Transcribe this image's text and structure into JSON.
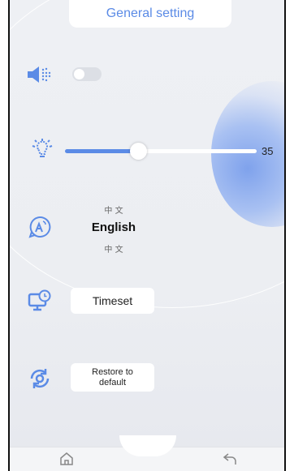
{
  "header": {
    "title": "General setting"
  },
  "sound": {
    "icon": "speaker-icon",
    "muted": true,
    "toggle_on": false
  },
  "brightness": {
    "icon": "lightbulb-icon",
    "value": "35",
    "level_fraction": 0.38
  },
  "language": {
    "icon": "language-icon",
    "options": [
      "中 文",
      "English",
      "中 文"
    ],
    "selected": "English"
  },
  "time": {
    "icon": "monitor-clock-icon",
    "button_label": "Timeset"
  },
  "restore": {
    "icon": "restore-icon",
    "button_label": "Restore to default"
  },
  "nav": {
    "home_icon": "home-icon",
    "back_icon": "back-arrow-icon"
  },
  "colors": {
    "accent": "#5b8be6",
    "background": "#eceef2"
  }
}
